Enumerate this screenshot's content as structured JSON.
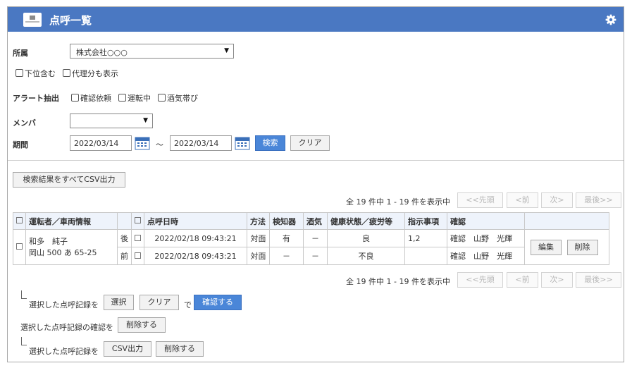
{
  "header": {
    "title": "点呼一覧",
    "logo_icon": "company-logo",
    "settings_icon": "gear-icon",
    "color": "#4a78c2"
  },
  "filters": {
    "affiliation_label": "所属",
    "affiliation_value": "株式会社○○○",
    "include_sub_label": "下位含む",
    "proxy_label": "代理分も表示",
    "alert_label": "アラート抽出",
    "alert_confirm_label": "確認依頼",
    "alert_driving_label": "運転中",
    "alert_alcohol_label": "酒気帯び",
    "member_label": "メンバ",
    "member_value": "",
    "period_label": "期間",
    "date_from": "2022/03/14",
    "tilde": "～",
    "date_to": "2022/03/14",
    "search_button": "検索",
    "clear_button": "クリア"
  },
  "csv_all_button": "検索結果をすべてCSV出力",
  "paging": {
    "summary": "全 19 件中 1 - 19 件を表示中",
    "first": "<<先頭",
    "prev": "<前",
    "next": "次>",
    "last": "最後>>"
  },
  "table": {
    "headers": {
      "check": "□",
      "driver": "運転者／車両情報",
      "check2": "□",
      "datetime": "点呼日時",
      "method": "方法",
      "detector": "検知器",
      "alcohol": "酒気",
      "health": "健康状態／疲労等",
      "instructions": "指示事項",
      "confirm": "確認"
    },
    "rows": [
      {
        "driver_name": "和多　純子",
        "vehicle": "岡山 500 あ 65-25",
        "edit_button": "編集",
        "delete_button": "削除",
        "records": [
          {
            "timing": "後",
            "datetime": "2022/02/18 09:43:21",
            "method": "対面",
            "detector": "有",
            "alcohol": "－",
            "health": "良",
            "instructions": "1,2",
            "confirm": "確認　山野　光輝"
          },
          {
            "timing": "前",
            "datetime": "2022/02/18 09:43:21",
            "method": "対面",
            "detector": "－",
            "alcohol": "－",
            "health": "不良",
            "instructions": "",
            "confirm": "確認　山野　光輝"
          }
        ]
      }
    ]
  },
  "actions": {
    "line1_label": "選択した点呼記録を",
    "select_button": "選択",
    "clear_button": "クリア",
    "de": "で",
    "confirm_button": "確認する",
    "line2_label": "選択した点呼記録の確認を",
    "delete_confirm_button": "削除する",
    "line3_label": "選択した点呼記録を",
    "csv_button": "CSV出力",
    "delete_button": "削除する"
  }
}
